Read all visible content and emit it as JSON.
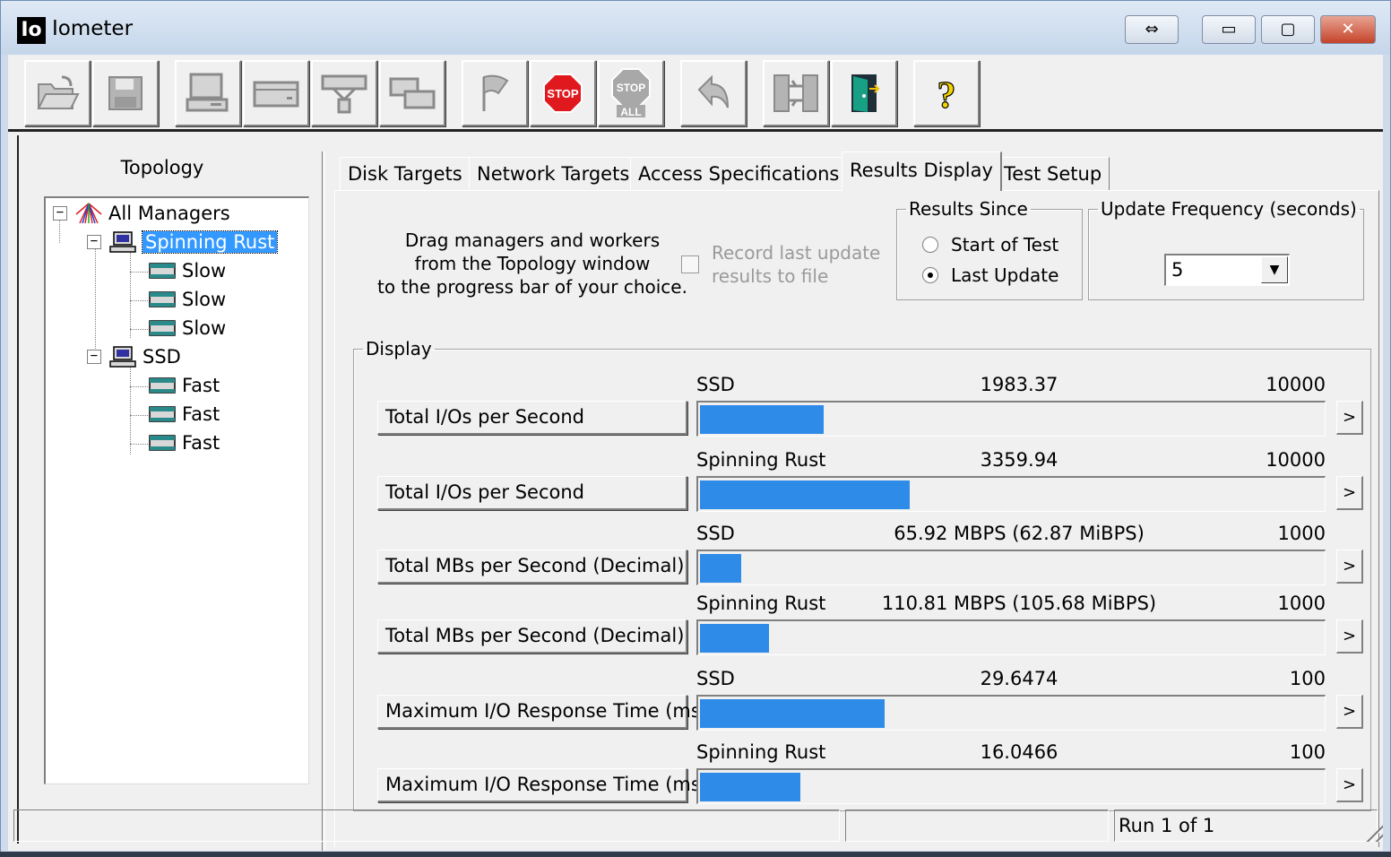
{
  "window": {
    "title": "Iometer",
    "app_icon_text": "Io"
  },
  "titlebar_buttons": {
    "restore_arrows": "⇔",
    "minimize": "▭",
    "maximize": "▢",
    "close": "✕"
  },
  "toolbar": {
    "stop_label": "STOP",
    "stop_all_label_top": "STOP",
    "stop_all_label_bottom": "ALL",
    "help_label": "?"
  },
  "topology": {
    "title": "Topology",
    "root": "All Managers",
    "managers": [
      {
        "name": "Spinning Rust",
        "workers": [
          "Slow",
          "Slow",
          "Slow"
        ]
      },
      {
        "name": "SSD",
        "workers": [
          "Fast",
          "Fast",
          "Fast"
        ]
      }
    ]
  },
  "tabs": [
    "Disk Targets",
    "Network Targets",
    "Access Specifications",
    "Results Display",
    "Test Setup"
  ],
  "active_tab": "Results Display",
  "results": {
    "drag_note": [
      "Drag managers and workers",
      "from the Topology window",
      "to the progress bar of your choice."
    ],
    "record_checkbox": {
      "label_line1": "Record last update",
      "label_line2": "results to file",
      "checked": false
    },
    "results_since": {
      "legend": "Results Since",
      "options": [
        "Start of Test",
        "Last Update"
      ],
      "selected": "Last Update"
    },
    "update_frequency": {
      "legend": "Update Frequency (seconds)",
      "value": "5"
    },
    "display_legend": "Display",
    "metrics": [
      {
        "button": "Total I/Os per Second",
        "target": "SSD",
        "value": "1983.37",
        "max": "10000",
        "fraction": 0.198337
      },
      {
        "button": "Total I/Os per Second",
        "target": "Spinning Rust",
        "value": "3359.94",
        "max": "10000",
        "fraction": 0.335994
      },
      {
        "button": "Total MBs per Second (Decimal)",
        "target": "SSD",
        "value": "65.92 MBPS (62.87 MiBPS)",
        "max": "1000",
        "fraction": 0.06592
      },
      {
        "button": "Total MBs per Second (Decimal)",
        "target": "Spinning Rust",
        "value": "110.81 MBPS (105.68 MiBPS)",
        "max": "1000",
        "fraction": 0.11081
      },
      {
        "button": "Maximum I/O Response Time (ms)",
        "target": "SSD",
        "value": "29.6474",
        "max": "100",
        "fraction": 0.296474
      },
      {
        "button": "Maximum I/O Response Time (ms)",
        "target": "Spinning Rust",
        "value": "16.0466",
        "max": "100",
        "fraction": 0.160466
      }
    ],
    "more_label": ">",
    "bar_color": "#2e8be8"
  },
  "statusbar": {
    "cell1": "",
    "cell2": "",
    "run_status": "Run 1 of 1"
  }
}
